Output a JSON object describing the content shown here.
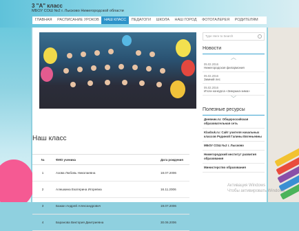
{
  "header": {
    "title": "3 \"А\" класс",
    "subtitle": "МБОУ СОШ №2 г. Лысково Нижегородской области"
  },
  "nav": [
    {
      "label": "ГЛАВНАЯ",
      "active": false
    },
    {
      "label": "РАСПИСАНИЕ УРОКОВ",
      "active": false
    },
    {
      "label": "НАШ КЛАСС",
      "active": true
    },
    {
      "label": "ПЕДАГОГИ",
      "active": false
    },
    {
      "label": "ШКОЛА",
      "active": false
    },
    {
      "label": "НАШ ГОРОД",
      "active": false
    },
    {
      "label": "ФОТОГАЛЕРЕЯ",
      "active": false
    },
    {
      "label": "РОДИТЕЛЯМ",
      "active": false
    }
  ],
  "main": {
    "heading": "Наш класс",
    "table": {
      "headers": [
        "№",
        "ФИО ученика",
        "Дата рождения"
      ],
      "rows": [
        [
          "1",
          "Азова Любовь Николаевна",
          "18.07.2006"
        ],
        [
          "2",
          "Алешкина Екатерина Игоревна",
          "16.11.2006"
        ],
        [
          "3",
          "Бажан Андрей Александрович",
          "19.07.2006"
        ],
        [
          "4",
          "Баранова Виктория Дмитриевна",
          "30.06.2006"
        ]
      ]
    }
  },
  "sidebar": {
    "search_placeholder": "Type Here to Search",
    "news_title": "Новости",
    "news": [
      {
        "date": "05.02.2016",
        "text": "Нижегородская филармония"
      },
      {
        "date": "05.02.2016",
        "text": "Зимний лес"
      },
      {
        "date": "05.02.2016",
        "text": "Итоги конкурса «Зимушка-зима»"
      }
    ],
    "resources_title": "Полезные ресурсы",
    "resources": [
      "Дневник.ru: Общероссийская образовательная сеть",
      "Klasbuk.ru: Сайт учителя начальных классов Родиной Галины Евгеньевны",
      "МБОУ СОШ №2 г. Лысково",
      "Нижегородский институт развития образования",
      "Министерство образования"
    ]
  },
  "watermark": {
    "line1": "Активация Windows",
    "line2": "Чтобы активировать Windows,"
  },
  "colors": {
    "accent": "#2d93c9",
    "background": "#8fd0df"
  }
}
